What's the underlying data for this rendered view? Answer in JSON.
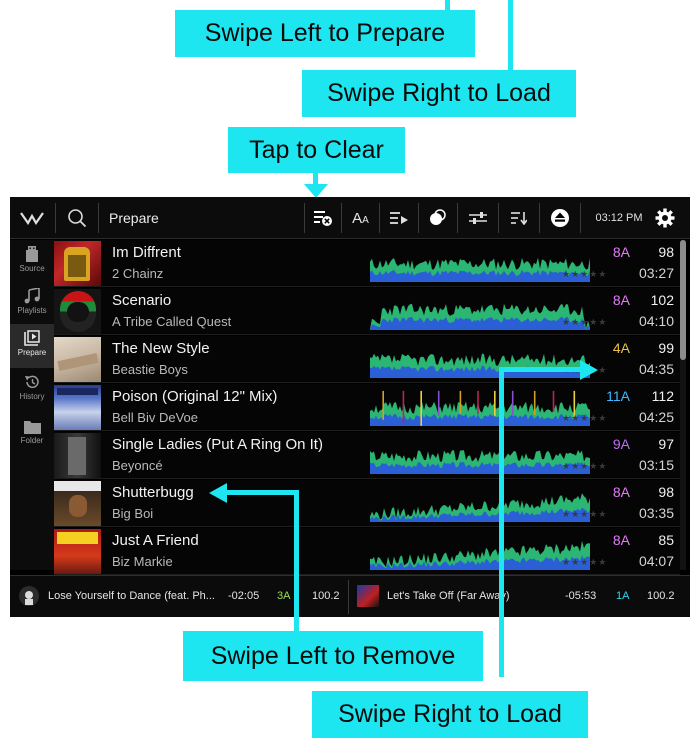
{
  "callouts": {
    "swipe_left_prepare": "Swipe Left to Prepare",
    "swipe_right_load_top": "Swipe Right to Load",
    "tap_to_clear": "Tap to Clear",
    "swipe_left_remove": "Swipe Left to Remove",
    "swipe_right_load_bottom": "Swipe Right to Load"
  },
  "topbar": {
    "title": "Prepare",
    "time": "03:12 PM",
    "icons": [
      "logo-icon",
      "search-icon",
      "clear-list-icon",
      "font-size-icon",
      "play-queue-icon",
      "color-filter-icon",
      "sliders-icon",
      "sort-icon",
      "eject-icon",
      "gear-icon"
    ]
  },
  "sidebar": {
    "items": [
      {
        "label": "Source",
        "icon": "usb-drive-icon"
      },
      {
        "label": "Playlists",
        "icon": "music-note-icon"
      },
      {
        "label": "Prepare",
        "icon": "prepare-icon"
      },
      {
        "label": "History",
        "icon": "history-icon"
      },
      {
        "label": "Folder",
        "icon": "folder-icon"
      }
    ],
    "active": "Prepare"
  },
  "tracks": [
    {
      "title": "Im Diffrent",
      "artist": "2 Chainz",
      "key": "8A",
      "key_color": "#e07ef5",
      "bpm": "98",
      "time": "03:27"
    },
    {
      "title": "Scenario",
      "artist": "A Tribe Called Quest",
      "key": "8A",
      "key_color": "#e07ef5",
      "bpm": "102",
      "time": "04:10"
    },
    {
      "title": "The New Style",
      "artist": "Beastie Boys",
      "key": "4A",
      "key_color": "#e8c24a",
      "bpm": "99",
      "time": "04:35"
    },
    {
      "title": "Poison (Original 12\" Mix)",
      "artist": "Bell Biv DeVoe",
      "key": "11A",
      "key_color": "#3fb8ff",
      "bpm": "112",
      "time": "04:25"
    },
    {
      "title": "Single Ladies (Put A Ring On It)",
      "artist": "Beyoncé",
      "key": "9A",
      "key_color": "#c06cf0",
      "bpm": "97",
      "time": "03:15"
    },
    {
      "title": "Shutterbugg",
      "artist": "Big Boi",
      "key": "8A",
      "key_color": "#e07ef5",
      "bpm": "98",
      "time": "03:35"
    },
    {
      "title": "Just A Friend",
      "artist": "Biz Markie",
      "key": "8A",
      "key_color": "#e07ef5",
      "bpm": "85",
      "time": "04:07"
    }
  ],
  "rating_stars": "★★★★★",
  "decks": {
    "left": {
      "title": "Lose Yourself to Dance (feat. Ph...",
      "remaining": "-02:05",
      "key": "3A",
      "key_color": "#9be34a",
      "bpm": "100.2"
    },
    "right": {
      "title": "Let's Take Off (Far Away)",
      "remaining": "-05:53",
      "key": "1A",
      "key_color": "#2fd6e8",
      "bpm": "100.2"
    }
  },
  "colors": {
    "callout": "#1ee6f0",
    "wave_green": "#2bb673",
    "wave_blue": "#2a5fd6",
    "background": "#000000"
  }
}
